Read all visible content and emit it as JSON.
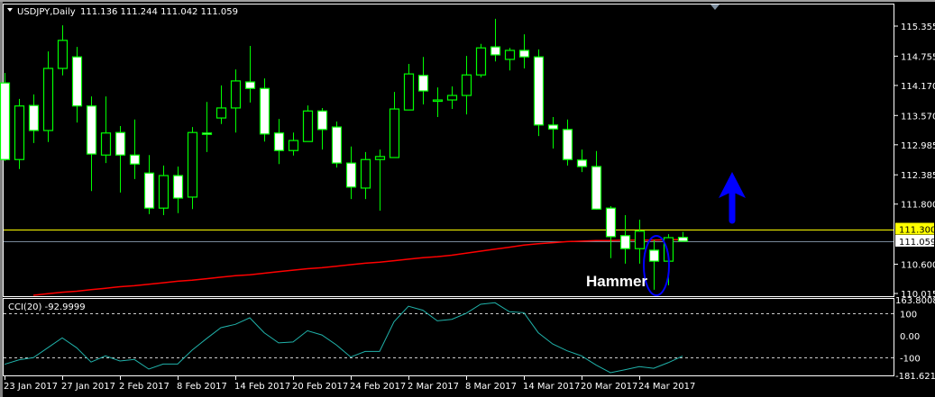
{
  "header": {
    "symbol_timeframe": "USDJPY,Daily",
    "ohlc_readout": "111.136 111.244 111.042 111.059"
  },
  "indicator": {
    "label": "CCI(20) -92.9999"
  },
  "colors": {
    "background": "#000000",
    "candle_outline": "#00ff00",
    "bull_body": "#000000",
    "bear_body": "#ffffff",
    "moving_average": "#ff0000",
    "cci_line": "#20b2aa",
    "ask_line": "#ffff00",
    "bid_line": "#778899",
    "annotation": "#0000ff"
  },
  "chart_data": [
    {
      "type": "candlestick",
      "title": "USDJPY,Daily",
      "ylim": [
        110.015,
        115.45
      ],
      "y_ticks": [
        "115.355",
        "114.755",
        "114.170",
        "113.570",
        "112.985",
        "112.385",
        "111.800",
        "110.600",
        "110.015"
      ],
      "x_ticks": [
        "23 Jan 2017",
        "27 Jan 2017",
        "2 Feb 2017",
        "8 Feb 2017",
        "14 Feb 2017",
        "20 Feb 2017",
        "24 Feb 2017",
        "2 Mar 2017",
        "8 Mar 2017",
        "14 Mar 2017",
        "20 Mar 2017",
        "24 Mar 2017"
      ],
      "grid": false,
      "candles": [
        {
          "date": "23 Jan 2017",
          "o": 114.22,
          "h": 114.42,
          "l": 112.66,
          "c": 112.69
        },
        {
          "date": "24 Jan 2017",
          "o": 112.69,
          "h": 113.9,
          "l": 112.5,
          "c": 113.76
        },
        {
          "date": "25 Jan 2017",
          "o": 113.77,
          "h": 113.99,
          "l": 113.02,
          "c": 113.27
        },
        {
          "date": "26 Jan 2017",
          "o": 113.27,
          "h": 114.85,
          "l": 113.04,
          "c": 114.51
        },
        {
          "date": "27 Jan 2017",
          "o": 114.51,
          "h": 115.37,
          "l": 114.37,
          "c": 115.07
        },
        {
          "date": "30 Jan 2017",
          "o": 114.74,
          "h": 114.94,
          "l": 113.43,
          "c": 113.76
        },
        {
          "date": "31 Jan 2017",
          "o": 113.76,
          "h": 113.95,
          "l": 112.06,
          "c": 112.8
        },
        {
          "date": "1 Feb 2017",
          "o": 112.78,
          "h": 113.95,
          "l": 112.62,
          "c": 113.22
        },
        {
          "date": "2 Feb 2017",
          "o": 113.23,
          "h": 113.36,
          "l": 112.03,
          "c": 112.78
        },
        {
          "date": "3 Feb 2017",
          "o": 112.78,
          "h": 113.49,
          "l": 112.3,
          "c": 112.6
        },
        {
          "date": "6 Feb 2017",
          "o": 112.42,
          "h": 112.78,
          "l": 111.6,
          "c": 111.72
        },
        {
          "date": "7 Feb 2017",
          "o": 111.72,
          "h": 112.57,
          "l": 111.58,
          "c": 112.37
        },
        {
          "date": "8 Feb 2017",
          "o": 112.37,
          "h": 112.55,
          "l": 111.62,
          "c": 111.92
        },
        {
          "date": "9 Feb 2017",
          "o": 111.94,
          "h": 113.34,
          "l": 111.7,
          "c": 113.23
        },
        {
          "date": "10 Feb 2017",
          "o": 113.22,
          "h": 113.84,
          "l": 112.84,
          "c": 113.21
        },
        {
          "date": "13 Feb 2017",
          "o": 113.52,
          "h": 114.17,
          "l": 113.4,
          "c": 113.72
        },
        {
          "date": "14 Feb 2017",
          "o": 113.72,
          "h": 114.49,
          "l": 113.23,
          "c": 114.26
        },
        {
          "date": "15 Feb 2017",
          "o": 114.24,
          "h": 114.96,
          "l": 113.83,
          "c": 114.11
        },
        {
          "date": "16 Feb 2017",
          "o": 114.11,
          "h": 114.31,
          "l": 113.05,
          "c": 113.2
        },
        {
          "date": "17 Feb 2017",
          "o": 113.22,
          "h": 113.5,
          "l": 112.6,
          "c": 112.87
        },
        {
          "date": "20 Feb 2017",
          "o": 112.87,
          "h": 113.23,
          "l": 112.77,
          "c": 113.07
        },
        {
          "date": "21 Feb 2017",
          "o": 113.05,
          "h": 113.77,
          "l": 113.05,
          "c": 113.66
        },
        {
          "date": "22 Feb 2017",
          "o": 113.66,
          "h": 113.72,
          "l": 112.89,
          "c": 113.29
        },
        {
          "date": "23 Feb 2017",
          "o": 113.34,
          "h": 113.45,
          "l": 112.53,
          "c": 112.62
        },
        {
          "date": "24 Feb 2017",
          "o": 112.62,
          "h": 112.95,
          "l": 111.9,
          "c": 112.14
        },
        {
          "date": "27 Feb 2017",
          "o": 112.12,
          "h": 112.84,
          "l": 111.9,
          "c": 112.69
        },
        {
          "date": "28 Feb 2017",
          "o": 112.69,
          "h": 112.89,
          "l": 111.67,
          "c": 112.75
        },
        {
          "date": "1 Mar 2017",
          "o": 112.73,
          "h": 114.04,
          "l": 112.73,
          "c": 113.7
        },
        {
          "date": "2 Mar 2017",
          "o": 113.68,
          "h": 114.6,
          "l": 113.68,
          "c": 114.4
        },
        {
          "date": "3 Mar 2017",
          "o": 114.37,
          "h": 114.74,
          "l": 113.79,
          "c": 114.06
        },
        {
          "date": "6 Mar 2017",
          "o": 113.88,
          "h": 114.13,
          "l": 113.54,
          "c": 113.88
        },
        {
          "date": "7 Mar 2017",
          "o": 113.88,
          "h": 114.15,
          "l": 113.7,
          "c": 113.97
        },
        {
          "date": "8 Mar 2017",
          "o": 113.97,
          "h": 114.76,
          "l": 113.59,
          "c": 114.38
        },
        {
          "date": "9 Mar 2017",
          "o": 114.38,
          "h": 115.0,
          "l": 114.33,
          "c": 114.92
        },
        {
          "date": "10 Mar 2017",
          "o": 114.94,
          "h": 115.5,
          "l": 114.65,
          "c": 114.78
        },
        {
          "date": "13 Mar 2017",
          "o": 114.69,
          "h": 114.92,
          "l": 114.47,
          "c": 114.87
        },
        {
          "date": "14 Mar 2017",
          "o": 114.87,
          "h": 115.19,
          "l": 114.51,
          "c": 114.74
        },
        {
          "date": "15 Mar 2017",
          "o": 114.74,
          "h": 114.89,
          "l": 113.16,
          "c": 113.38
        },
        {
          "date": "16 Mar 2017",
          "o": 113.38,
          "h": 113.54,
          "l": 112.91,
          "c": 113.3
        },
        {
          "date": "17 Mar 2017",
          "o": 113.29,
          "h": 113.49,
          "l": 112.57,
          "c": 112.69
        },
        {
          "date": "20 Mar 2017",
          "o": 112.68,
          "h": 112.89,
          "l": 112.44,
          "c": 112.55
        },
        {
          "date": "21 Mar 2017",
          "o": 112.55,
          "h": 112.86,
          "l": 111.69,
          "c": 111.7
        },
        {
          "date": "22 Mar 2017",
          "o": 111.72,
          "h": 111.76,
          "l": 110.72,
          "c": 111.15
        },
        {
          "date": "23 Mar 2017",
          "o": 111.17,
          "h": 111.58,
          "l": 110.61,
          "c": 110.91
        },
        {
          "date": "24 Mar 2017",
          "o": 110.91,
          "h": 111.49,
          "l": 110.61,
          "c": 111.26
        },
        {
          "date": "27 Mar 2017",
          "o": 110.88,
          "h": 111.08,
          "l": 110.09,
          "c": 110.66
        },
        {
          "date": "28 Mar 2017",
          "o": 110.66,
          "h": 111.2,
          "l": 110.18,
          "c": 111.13
        },
        {
          "date": "29 Mar 2017",
          "o": 111.136,
          "h": 111.244,
          "l": 111.042,
          "c": 111.059
        }
      ],
      "moving_average": [
        null,
        null,
        109.98,
        110.01,
        110.04,
        110.06,
        110.09,
        110.12,
        110.15,
        110.17,
        110.2,
        110.23,
        110.26,
        110.28,
        110.31,
        110.34,
        110.37,
        110.39,
        110.42,
        110.45,
        110.48,
        110.51,
        110.53,
        110.56,
        110.59,
        110.62,
        110.64,
        110.67,
        110.7,
        110.73,
        110.75,
        110.78,
        110.82,
        110.86,
        110.9,
        110.94,
        110.98,
        111.01,
        111.03,
        111.05,
        111.06,
        111.07,
        111.07,
        111.08,
        111.08,
        111.08,
        111.09,
        111.09
      ],
      "price_tags": [
        {
          "label": "111.300",
          "value": 111.3,
          "color": "#ffff00"
        },
        {
          "label": "111.059",
          "value": 111.059,
          "color": "#ffffff"
        }
      ],
      "annotations": {
        "text": "Hammer",
        "highlighted_date": "27 Mar 2017",
        "arrow": "up"
      }
    },
    {
      "type": "line",
      "title": "CCI(20) -92.9999",
      "ylim": [
        -181.6217,
        163.8008
      ],
      "y_ticks": [
        "163.8008",
        "100",
        "0.00",
        "-100",
        "-181.6217"
      ],
      "levels": [
        100,
        -100
      ],
      "values": [
        -130,
        -110,
        -100,
        -55,
        -10,
        -55,
        -120,
        -92,
        -115,
        -108,
        -152,
        -129,
        -129,
        -66,
        -14,
        36,
        51,
        81,
        13,
        -33,
        -29,
        22,
        3,
        -42,
        -97,
        -72,
        -72,
        63,
        133,
        115,
        67,
        74,
        101,
        142,
        149,
        108,
        104,
        13,
        -38,
        -69,
        -92,
        -133,
        -168,
        -155,
        -141,
        -148,
        -123,
        -93
      ]
    }
  ]
}
